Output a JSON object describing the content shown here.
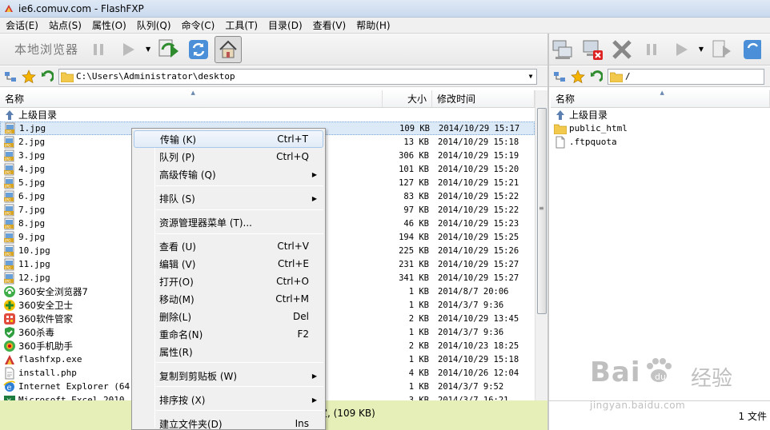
{
  "window": {
    "title": "ie6.comuv.com - FlashFXP"
  },
  "menu": [
    "会话(E)",
    "站点(S)",
    "属性(O)",
    "队列(Q)",
    "命令(C)",
    "工具(T)",
    "目录(D)",
    "查看(V)",
    "帮助(H)"
  ],
  "local_toolbar": {
    "label": "本地浏览器"
  },
  "local_path": "C:\\Users\\Administrator\\desktop",
  "remote_path": "/",
  "local_columns": {
    "name": "名称",
    "size": "大小",
    "time": "修改时间"
  },
  "remote_columns": {
    "name": "名称"
  },
  "updir_label": "上级目录",
  "local_files": [
    {
      "name": "1.jpg",
      "size": "109 KB",
      "time": "2014/10/29 15:17",
      "icon": "jpg-icon",
      "cn": false
    },
    {
      "name": "2.jpg",
      "size": "13 KB",
      "time": "2014/10/29 15:18",
      "icon": "jpg-icon",
      "cn": false
    },
    {
      "name": "3.jpg",
      "size": "306 KB",
      "time": "2014/10/29 15:19",
      "icon": "jpg-icon",
      "cn": false
    },
    {
      "name": "4.jpg",
      "size": "101 KB",
      "time": "2014/10/29 15:20",
      "icon": "jpg-icon",
      "cn": false
    },
    {
      "name": "5.jpg",
      "size": "127 KB",
      "time": "2014/10/29 15:21",
      "icon": "jpg-icon",
      "cn": false
    },
    {
      "name": "6.jpg",
      "size": "83 KB",
      "time": "2014/10/29 15:22",
      "icon": "jpg-icon",
      "cn": false
    },
    {
      "name": "7.jpg",
      "size": "97 KB",
      "time": "2014/10/29 15:22",
      "icon": "jpg-icon",
      "cn": false
    },
    {
      "name": "8.jpg",
      "size": "46 KB",
      "time": "2014/10/29 15:23",
      "icon": "jpg-icon",
      "cn": false
    },
    {
      "name": "9.jpg",
      "size": "194 KB",
      "time": "2014/10/29 15:25",
      "icon": "jpg-icon",
      "cn": false
    },
    {
      "name": "10.jpg",
      "size": "225 KB",
      "time": "2014/10/29 15:26",
      "icon": "jpg-icon",
      "cn": false
    },
    {
      "name": "11.jpg",
      "size": "231 KB",
      "time": "2014/10/29 15:27",
      "icon": "jpg-icon",
      "cn": false
    },
    {
      "name": "12.jpg",
      "size": "341 KB",
      "time": "2014/10/29 15:27",
      "icon": "jpg-icon",
      "cn": false
    },
    {
      "name": "360安全浏览器7",
      "size": "1 KB",
      "time": "2014/8/7 20:06",
      "icon": "360-browser-icon",
      "cn": true
    },
    {
      "name": "360安全卫士",
      "size": "1 KB",
      "time": "2014/3/7 9:36",
      "icon": "360-safe-icon",
      "cn": true
    },
    {
      "name": "360软件管家",
      "size": "2 KB",
      "time": "2014/10/29 13:45",
      "icon": "360-software-icon",
      "cn": true
    },
    {
      "name": "360杀毒",
      "size": "1 KB",
      "time": "2014/3/7 9:36",
      "icon": "360-antivirus-icon",
      "cn": true
    },
    {
      "name": "360手机助手",
      "size": "2 KB",
      "time": "2014/10/23 18:25",
      "icon": "360-mobile-icon",
      "cn": true
    },
    {
      "name": "flashfxp.exe",
      "size": "1 KB",
      "time": "2014/10/29 15:18",
      "icon": "flashfxp-icon",
      "cn": false
    },
    {
      "name": "install.php",
      "size": "4 KB",
      "time": "2014/10/26 12:04",
      "icon": "php-file-icon",
      "cn": false
    },
    {
      "name": "Internet Explorer (64-bi",
      "size": "1 KB",
      "time": "2014/3/7 9:52",
      "icon": "ie-icon",
      "cn": false
    },
    {
      "name": "Microsoft Excel 2010",
      "size": "3 KB",
      "time": "2014/3/7 16:21",
      "icon": "excel-icon",
      "cn": false
    }
  ],
  "remote_files": [
    {
      "name": "public_html",
      "icon": "folder-icon"
    },
    {
      "name": ".ftpquota",
      "icon": "file-icon"
    }
  ],
  "context_menu": [
    {
      "label": "传输 (K)",
      "shortcut": "Ctrl+T",
      "sub": false,
      "hl": true
    },
    {
      "label": "队列 (P)",
      "shortcut": "Ctrl+Q",
      "sub": false
    },
    {
      "label": "高级传输 (Q)",
      "shortcut": "",
      "sub": true
    },
    {
      "label": "排队 (S)",
      "shortcut": "",
      "sub": true
    },
    {
      "label": "资源管理器菜单 (T)...",
      "shortcut": "",
      "sub": false
    },
    {
      "label": "查看 (U)",
      "shortcut": "Ctrl+V",
      "sub": false
    },
    {
      "label": "编辑 (V)",
      "shortcut": "Ctrl+E",
      "sub": false
    },
    {
      "label": "打开(O)",
      "shortcut": "Ctrl+O",
      "sub": false
    },
    {
      "label": "移动(M)",
      "shortcut": "Ctrl+M",
      "sub": false
    },
    {
      "label": "删除(L)",
      "shortcut": "Del",
      "sub": false
    },
    {
      "label": "重命名(N)",
      "shortcut": "F2",
      "sub": false
    },
    {
      "label": "属性(R)",
      "shortcut": "",
      "sub": false
    },
    {
      "label": "复制到剪贴板 (W)",
      "shortcut": "",
      "sub": true
    },
    {
      "label": "排序按 (X)",
      "shortcut": "",
      "sub": true
    },
    {
      "label": "建立文件夹(D)",
      "shortcut": "Ins",
      "sub": false
    }
  ],
  "status": {
    "left": "定, (109 KB)",
    "right": "1 文件"
  },
  "watermark": {
    "brand": "Bai",
    "brand_suffix": "经验",
    "url": "jingyan.baidu.com"
  }
}
